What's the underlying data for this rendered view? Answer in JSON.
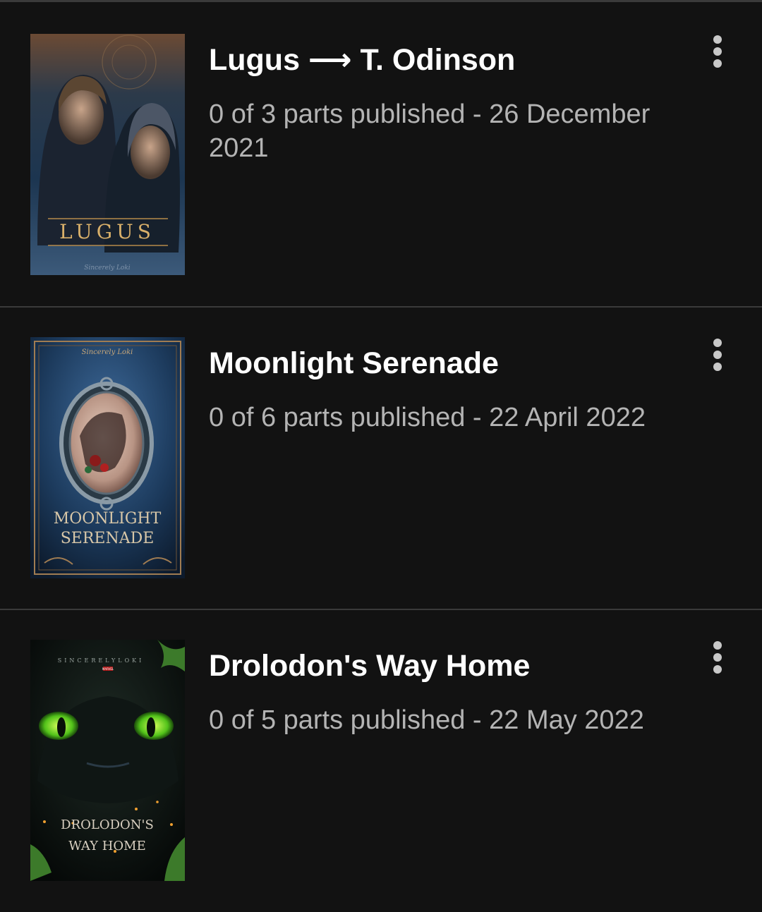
{
  "stories": [
    {
      "title": "Lugus ⟶ T. Odinson",
      "meta": "0 of 3 parts published - 26 December 2021",
      "cover": {
        "title": "LUGUS",
        "author": "Sincerely Loki"
      },
      "menu_icon": "more-vertical-icon"
    },
    {
      "title": "Moonlight Serenade",
      "meta": "0 of 6 parts published - 22 April 2022",
      "cover": {
        "title_line1": "MOONLIGHT",
        "title_line2": "SERENADE",
        "author": "Sincerely Loki"
      },
      "menu_icon": "more-vertical-icon"
    },
    {
      "title": "Drolodon's Way Home",
      "meta": "0 of 5 parts published - 22 May 2022",
      "cover": {
        "title_line1": "DROLODON'S",
        "title_line2": "WAY HOME",
        "author": "SINCERELYLOKI",
        "badge": "MARVEL"
      },
      "menu_icon": "more-vertical-icon"
    }
  ],
  "colors": {
    "background": "#121212",
    "divider": "#3a3a3a",
    "title": "#ffffff",
    "meta": "#b4b4b4"
  }
}
